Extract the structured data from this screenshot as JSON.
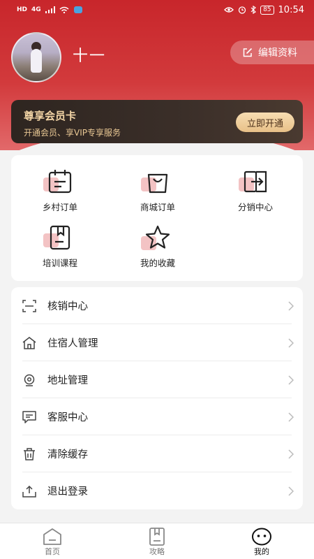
{
  "status_bar": {
    "left": [
      "HD",
      "4G"
    ],
    "time": "10:54",
    "battery": "85"
  },
  "profile": {
    "username": "十一",
    "edit_label": "编辑资料"
  },
  "vip": {
    "title": "尊享会员卡",
    "subtitle": "开通会员、享VIP专享服务",
    "button": "立即开通"
  },
  "quick_grid": [
    {
      "label": "乡村订单",
      "icon": "calendar-icon"
    },
    {
      "label": "商城订单",
      "icon": "shopping-bag-icon"
    },
    {
      "label": "分销中心",
      "icon": "share-exit-icon"
    },
    {
      "label": "培训课程",
      "icon": "book-icon"
    },
    {
      "label": "我的收藏",
      "icon": "star-icon"
    }
  ],
  "menu": [
    {
      "label": "核销中心",
      "icon": "scan-icon"
    },
    {
      "label": "住宿人管理",
      "icon": "home-icon"
    },
    {
      "label": "地址管理",
      "icon": "location-pin-icon"
    },
    {
      "label": "客服中心",
      "icon": "chat-icon"
    },
    {
      "label": "清除缓存",
      "icon": "trash-icon"
    },
    {
      "label": "退出登录",
      "icon": "upload-icon"
    }
  ],
  "tabs": [
    {
      "label": "首页",
      "icon": "home-tab-icon",
      "active": false
    },
    {
      "label": "攻略",
      "icon": "guide-tab-icon",
      "active": false
    },
    {
      "label": "我的",
      "icon": "profile-face-icon",
      "active": true
    }
  ]
}
